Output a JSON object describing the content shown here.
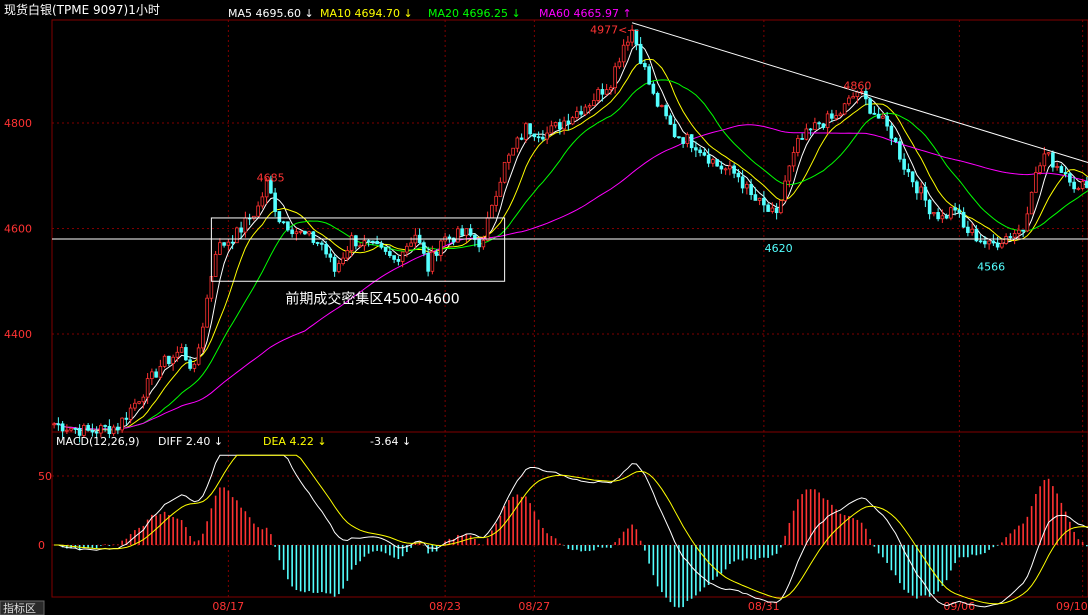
{
  "header": {
    "title": "现货白银(TPME 9097)1小时",
    "ma_items": [
      {
        "label": "MA5 4695.60 ↓",
        "color": "#ffffff"
      },
      {
        "label": "MA10 4694.70 ↓",
        "color": "#ffff00"
      },
      {
        "label": "MA20 4696.25 ↓",
        "color": "#00ff00"
      },
      {
        "label": "MA60 4665.97 ↑",
        "color": "#ff00ff"
      }
    ]
  },
  "macd_header": {
    "name": "MACD(12,26,9)",
    "diff": "DIFF  2.40 ↓",
    "dea": "DEA  4.22 ↓",
    "macd": "-3.64 ↓"
  },
  "footer": {
    "tab_label": "指标区"
  },
  "annotations": {
    "box_label": "前期成交密集区4500-4600",
    "peak_high": "4977<---",
    "peak_4860": "4860",
    "peak_4685": "4685",
    "low_4620": "4620",
    "low_4566": "4566"
  },
  "colors": {
    "background": "#000000",
    "grid": "#800000",
    "axis_label": "#ff3333",
    "up_candle": "#ff3232",
    "down_candle": "#54ffff",
    "ma5": "#ffffff",
    "ma10": "#ffff00",
    "ma20": "#00ff00",
    "ma60": "#ff00ff"
  },
  "chart_data": {
    "type": "candlestick",
    "price_axis": {
      "ticks": [
        4400,
        4600,
        4800
      ],
      "range": [
        4200,
        5000
      ]
    },
    "macd_axis": {
      "ticks": [
        50,
        0
      ],
      "range": [
        -80,
        70
      ]
    },
    "date_ticks": [
      "08/17",
      "08/23",
      "08/27",
      "08/31",
      "09/06",
      "09/10"
    ],
    "price_path": [
      [
        0,
        4230
      ],
      [
        8,
        4215
      ],
      [
        15,
        4225
      ],
      [
        20,
        4280
      ],
      [
        25,
        4340
      ],
      [
        30,
        4370
      ],
      [
        33,
        4330
      ],
      [
        35,
        4420
      ],
      [
        38,
        4560
      ],
      [
        43,
        4590
      ],
      [
        48,
        4640
      ],
      [
        50,
        4685
      ],
      [
        53,
        4620
      ],
      [
        58,
        4590
      ],
      [
        63,
        4570
      ],
      [
        66,
        4520
      ],
      [
        70,
        4580
      ],
      [
        76,
        4560
      ],
      [
        80,
        4540
      ],
      [
        85,
        4590
      ],
      [
        88,
        4525
      ],
      [
        91,
        4580
      ],
      [
        97,
        4590
      ],
      [
        101,
        4570
      ],
      [
        103,
        4650
      ],
      [
        106,
        4720
      ],
      [
        111,
        4790
      ],
      [
        116,
        4780
      ],
      [
        121,
        4810
      ],
      [
        126,
        4840
      ],
      [
        131,
        4880
      ],
      [
        134,
        4950
      ],
      [
        136,
        4977
      ],
      [
        139,
        4900
      ],
      [
        141,
        4850
      ],
      [
        146,
        4780
      ],
      [
        151,
        4760
      ],
      [
        156,
        4720
      ],
      [
        161,
        4700
      ],
      [
        164,
        4660
      ],
      [
        167,
        4640
      ],
      [
        170,
        4620
      ],
      [
        172,
        4690
      ],
      [
        175,
        4760
      ],
      [
        180,
        4800
      ],
      [
        184,
        4810
      ],
      [
        187,
        4840
      ],
      [
        189,
        4860
      ],
      [
        193,
        4820
      ],
      [
        197,
        4780
      ],
      [
        200,
        4720
      ],
      [
        203,
        4680
      ],
      [
        206,
        4640
      ],
      [
        209,
        4620
      ],
      [
        212,
        4640
      ],
      [
        214,
        4600
      ],
      [
        218,
        4580
      ],
      [
        220,
        4566
      ],
      [
        225,
        4590
      ],
      [
        228,
        4600
      ],
      [
        230,
        4680
      ],
      [
        233,
        4740
      ],
      [
        236,
        4720
      ],
      [
        239,
        4700
      ],
      [
        241,
        4670
      ],
      [
        243,
        4690
      ],
      [
        246,
        4700
      ],
      [
        249,
        4695
      ]
    ],
    "levels": [
      {
        "name": "support",
        "value": 4580
      },
      {
        "name": "resistance-trendline",
        "from": [
          136,
          4990
        ],
        "to": [
          249,
          4725
        ]
      }
    ],
    "box": {
      "x_range": [
        37,
        106
      ],
      "y_range": [
        4500,
        4620
      ]
    },
    "series": [
      {
        "name": "MA5",
        "latest": 4695.6
      },
      {
        "name": "MA10",
        "latest": 4694.7
      },
      {
        "name": "MA20",
        "latest": 4696.25
      },
      {
        "name": "MA60",
        "latest": 4665.97
      }
    ],
    "macd": {
      "diff": 2.4,
      "dea": 4.22,
      "histogram": -3.64
    }
  }
}
